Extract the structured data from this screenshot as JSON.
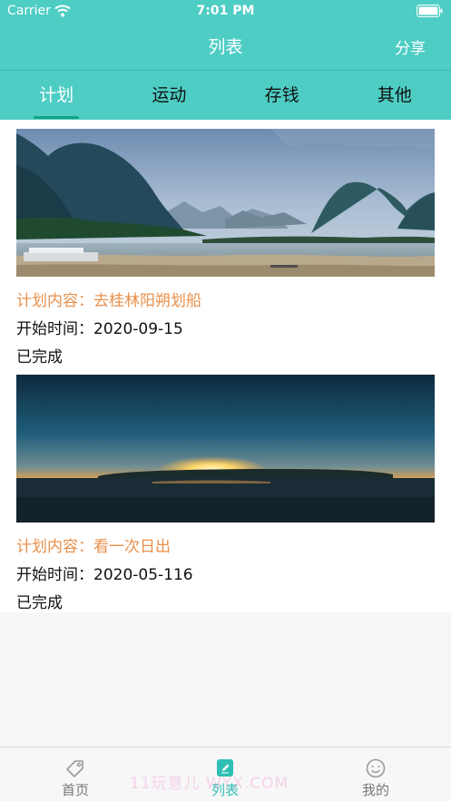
{
  "status_bar": {
    "carrier": "Carrier",
    "time": "7:01 PM"
  },
  "nav": {
    "title": "列表",
    "share_label": "分享"
  },
  "tabs": [
    {
      "label": "计划",
      "active": true
    },
    {
      "label": "运动",
      "active": false
    },
    {
      "label": "存钱",
      "active": false
    },
    {
      "label": "其他",
      "active": false
    }
  ],
  "plans": [
    {
      "image": "landscape-mountains-river",
      "content_label": "计划内容：",
      "content_value": "去桂林阳朔划船",
      "start_label": "开始时间：",
      "start_value": "2020-09-15",
      "status": "已完成"
    },
    {
      "image": "sunrise-over-sea",
      "content_label": "计划内容：",
      "content_value": "看一次日出",
      "start_label": "开始时间：",
      "start_value": "2020-05-116",
      "status": "已完成"
    }
  ],
  "bottom_tabs": [
    {
      "label": "首页",
      "icon": "tag-icon",
      "active": false
    },
    {
      "label": "列表",
      "icon": "edit-icon",
      "active": true
    },
    {
      "label": "我的",
      "icon": "smile-icon",
      "active": false
    }
  ],
  "watermark": "11玩意儿 WYX.COM",
  "colors": {
    "accent": "#4ecdc4",
    "indicator": "#13a383",
    "orange_text": "#e9904c",
    "active_tab_label": "#2fbfb5"
  }
}
